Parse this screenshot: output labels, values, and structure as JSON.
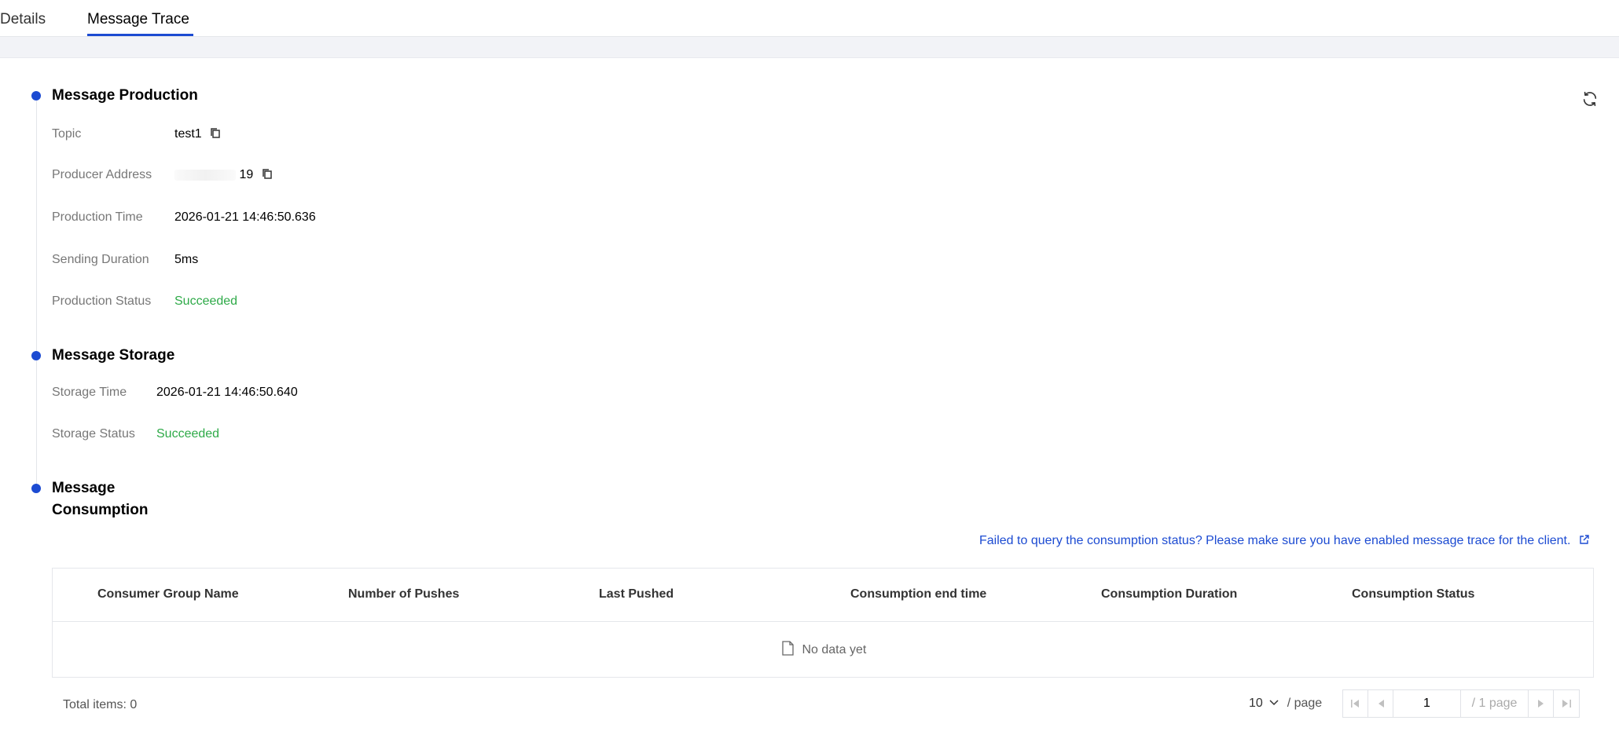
{
  "tabs": [
    {
      "label": "Details",
      "active": false
    },
    {
      "label": "Message Trace",
      "active": true
    }
  ],
  "production": {
    "title": "Message Production",
    "fields": {
      "topic": {
        "label": "Topic",
        "value": "test1"
      },
      "producer_address": {
        "label": "Producer Address",
        "value": "19"
      },
      "production_time": {
        "label": "Production Time",
        "value": "2026-01-21 14:46:50.636"
      },
      "sending_duration": {
        "label": "Sending Duration",
        "value": "5ms"
      },
      "production_status": {
        "label": "Production Status",
        "value": "Succeeded"
      }
    }
  },
  "storage": {
    "title": "Message Storage",
    "fields": {
      "storage_time": {
        "label": "Storage Time",
        "value": "2026-01-21 14:46:50.640"
      },
      "storage_status": {
        "label": "Storage Status",
        "value": "Succeeded"
      }
    }
  },
  "consumption": {
    "title_line1": "Message",
    "title_line2": "Consumption",
    "help_link": "Failed to query the consumption status? Please make sure you have enabled message trace for the client.",
    "columns": [
      "Consumer Group Name",
      "Number of Pushes",
      "Last Pushed",
      "Consumption end time",
      "Consumption Duration",
      "Consumption Status"
    ],
    "rows": [],
    "empty_text": "No data yet"
  },
  "pagination": {
    "total": "Total items: 0",
    "page_size": "10",
    "per_page_label": "/ page",
    "current_page": "1",
    "total_pages": "/ 1 page"
  },
  "colors": {
    "accent": "#1c4bd2",
    "success": "#2eaa48",
    "label": "#777777"
  },
  "icons": {
    "refresh": "refresh-icon",
    "copy": "copy-icon",
    "external": "external-link-icon",
    "empty": "file-icon"
  }
}
